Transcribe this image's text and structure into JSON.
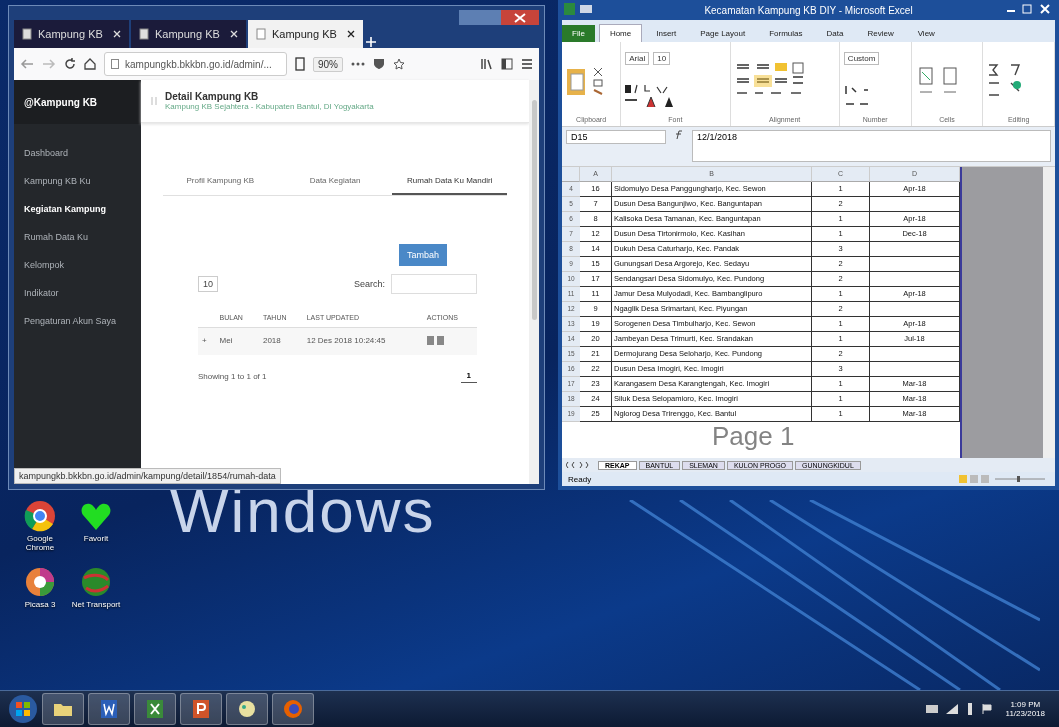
{
  "wallpaper": {
    "text": "Windows"
  },
  "browser": {
    "tabs": [
      {
        "title": "Kampung KB",
        "selected": false
      },
      {
        "title": "Kampung KB",
        "selected": false
      },
      {
        "title": "Kampung KB",
        "selected": true
      }
    ],
    "url": "kampungkb.bkkbn.go.id/admin/...",
    "zoom": "90%",
    "sidebar": {
      "brand": "@Kampung KB",
      "items": [
        {
          "label": "Dashboard",
          "selected": false
        },
        {
          "label": "Kampung KB Ku",
          "selected": false
        },
        {
          "label": "Kegiatan Kampung",
          "selected": true
        },
        {
          "label": "Rumah Data Ku",
          "selected": false
        },
        {
          "label": "Kelompok",
          "selected": false
        },
        {
          "label": "Indikator",
          "selected": false
        },
        {
          "label": "Pengaturan Akun Saya",
          "selected": false
        }
      ]
    },
    "header": {
      "title": "Detail Kampung KB",
      "subtitle": "Kampung KB Sejahtera - Kabupaten Bantul, DI Yogyakarta"
    },
    "page_tabs": [
      {
        "label": "Profil Kampung KB",
        "selected": false
      },
      {
        "label": "Data Kegiatan",
        "selected": false
      },
      {
        "label": "Rumah Data Ku Mandiri",
        "selected": true
      }
    ],
    "add_button": "Tambah",
    "page_length": "10",
    "search": {
      "label": "Search:"
    },
    "table": {
      "columns": [
        "BULAN",
        "TAHUN",
        "LAST UPDATED",
        "ACTIONS"
      ],
      "rows": [
        {
          "expander": "+",
          "cells": [
            "Mei",
            "2018",
            "12 Des 2018 10:24:45"
          ]
        }
      ]
    },
    "info": "Showing 1 to 1 of 1",
    "pages": [
      {
        "label": "1",
        "selected": true
      }
    ],
    "status_url": "kampungkb.bkkbn.go.id/admin/kampung/detail/1854/rumah-data"
  },
  "excel": {
    "title": "Kecamatan Kampung KB DIY - Microsoft Excel",
    "ribbon_tabs": [
      {
        "label": "File",
        "selected": false,
        "kind": "file"
      },
      {
        "label": "Home",
        "selected": true,
        "kind": "tab"
      },
      {
        "label": "Insert",
        "selected": false,
        "kind": "tab"
      },
      {
        "label": "Page Layout",
        "selected": false,
        "kind": "tab"
      },
      {
        "label": "Formulas",
        "selected": false,
        "kind": "tab"
      },
      {
        "label": "Data",
        "selected": false,
        "kind": "tab"
      },
      {
        "label": "Review",
        "selected": false,
        "kind": "tab"
      },
      {
        "label": "View",
        "selected": false,
        "kind": "tab"
      }
    ],
    "font": "Arial",
    "font_size": "10",
    "number_format": "Custom",
    "groups": [
      "Clipboard",
      "Font",
      "Alignment",
      "Number",
      "Cells",
      "Editing"
    ],
    "name_box": "D15",
    "formula": "12/1/2018",
    "columns": [
      "A",
      "B",
      "C",
      "D"
    ],
    "rows": [
      {
        "row": "4",
        "no": "16",
        "name": "Sidomulyo Desa Panggungharjo, Kec. Sewon",
        "count": "1",
        "date": "Apr-18"
      },
      {
        "row": "5",
        "no": "7",
        "name": "Dusun Desa Bangunjiwo, Kec. Banguntapan",
        "count": "2",
        "date": ""
      },
      {
        "row": "6",
        "no": "8",
        "name": "Kalisoka Desa Tamanan, Kec. Banguntapan",
        "count": "1",
        "date": "Apr-18"
      },
      {
        "row": "7",
        "no": "12",
        "name": "Dusun Desa Tirtonirmolo, Kec. Kasihan",
        "count": "1",
        "date": "Dec-18"
      },
      {
        "row": "8",
        "no": "14",
        "name": "Dukuh Desa Caturharjo, Kec. Pandak",
        "count": "3",
        "date": ""
      },
      {
        "row": "9",
        "no": "15",
        "name": "Gunungsari Desa Argorejo, Kec. Sedayu",
        "count": "2",
        "date": ""
      },
      {
        "row": "10",
        "no": "17",
        "name": "Sendangsari Desa Sidomulyo, Kec. Pundong",
        "count": "2",
        "date": ""
      },
      {
        "row": "11",
        "no": "11",
        "name": "Jamur Desa Mulyodadi, Kec. Bambanglipuro",
        "count": "1",
        "date": "Apr-18"
      },
      {
        "row": "12",
        "no": "9",
        "name": "Ngaglik Desa Srimartani, Kec. Piyungan",
        "count": "2",
        "date": ""
      },
      {
        "row": "13",
        "no": "19",
        "name": "Sorogenen Desa Timbulharjo, Kec. Sewon",
        "count": "1",
        "date": "Apr-18"
      },
      {
        "row": "14",
        "no": "20",
        "name": "Jambeyan Desa Trimurti, Kec. Srandakan",
        "count": "1",
        "date": "Jul-18"
      },
      {
        "row": "15",
        "no": "21",
        "name": "Dermojurang Desa Seloharjo, Kec. Pundong",
        "count": "2",
        "date": ""
      },
      {
        "row": "16",
        "no": "22",
        "name": "Dusun Desa Imogiri, Kec. Imogiri",
        "count": "3",
        "date": ""
      },
      {
        "row": "17",
        "no": "23",
        "name": "Karangasem Desa Karangtengah, Kec. Imogiri",
        "count": "1",
        "date": "Mar-18"
      },
      {
        "row": "18",
        "no": "24",
        "name": "Siluk Desa Selopamioro, Kec. Imogiri",
        "count": "1",
        "date": "Mar-18"
      },
      {
        "row": "19",
        "no": "25",
        "name": "Nglorog Desa Trirenggo, Kec. Bantul",
        "count": "1",
        "date": "Mar-18"
      }
    ],
    "page_watermark": "Page 1",
    "sheet_tabs": [
      {
        "label": "REKAP",
        "selected": true
      },
      {
        "label": "BANTUL",
        "selected": false
      },
      {
        "label": "SLEMAN",
        "selected": false
      },
      {
        "label": "KULON PROGO",
        "selected": false
      },
      {
        "label": "GUNUNGKIDUL",
        "selected": false
      }
    ],
    "status": "Ready"
  },
  "desktop_icons": [
    {
      "label": "Google Chrome",
      "kind": "chrome"
    },
    {
      "label": "Favorit",
      "kind": "heart"
    },
    {
      "label": "Picasa 3",
      "kind": "picasa"
    },
    {
      "label": "Net Transport",
      "kind": "globe"
    }
  ],
  "taskbar": {
    "apps": [
      {
        "kind": "explorer"
      },
      {
        "kind": "word"
      },
      {
        "kind": "excel"
      },
      {
        "kind": "powerpoint"
      },
      {
        "kind": "paint"
      },
      {
        "kind": "firefox"
      }
    ],
    "time": "1:09 PM",
    "date": "11/23/2018"
  }
}
